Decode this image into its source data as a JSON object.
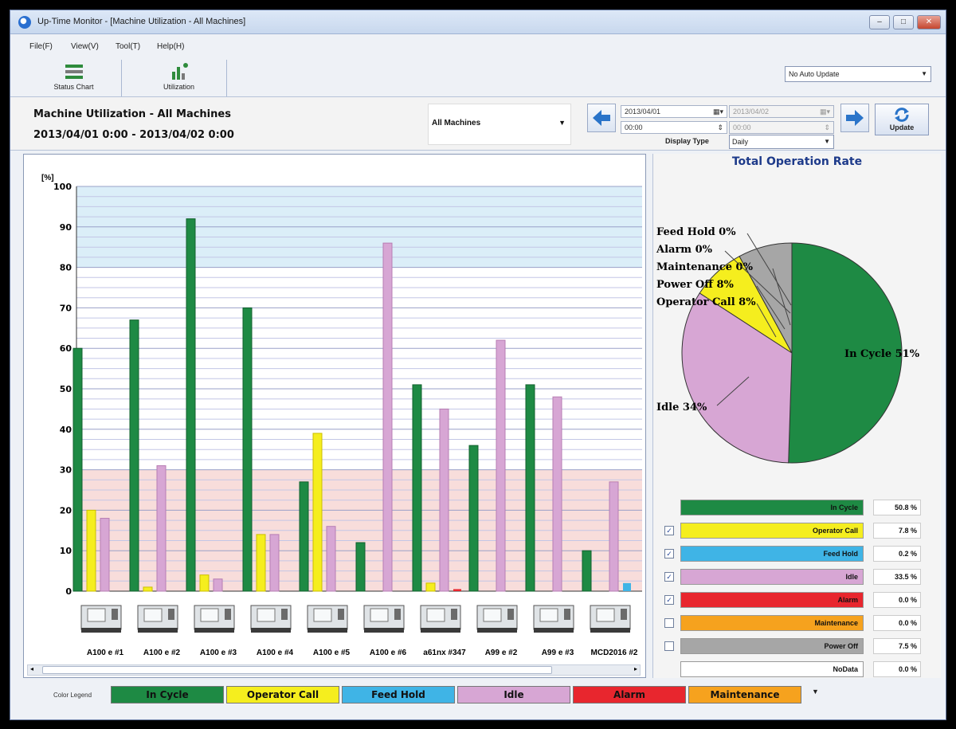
{
  "window": {
    "title": "Up-Time Monitor - [Machine Utilization - All Machines]",
    "controls": [
      "–",
      "□",
      "✕"
    ]
  },
  "menu": [
    "File(F)",
    "View(V)",
    "Tool(T)",
    "Help(H)"
  ],
  "toolbar": {
    "status_chart_label": "Status Chart",
    "utilization_label": "Utilization",
    "auto_update_value": "No Auto Update"
  },
  "header": {
    "title": "Machine Utilization - All Machines",
    "range": "2013/04/01 0:00 - 2013/04/02 0:00",
    "machine_select_value": "All Machines",
    "start_date": "2013/04/01",
    "start_time": "00:00",
    "end_date": "2013/04/02",
    "end_time": "00:00",
    "update_label": "Update",
    "display_type_label": "Display Type",
    "display_type_value": "Daily"
  },
  "colors": {
    "in_cycle": "#1e8a44",
    "operator_call": "#f5ee1e",
    "feed_hold": "#3fb4e6",
    "idle": "#d7a6d4",
    "alarm": "#e8262e",
    "maintenance": "#f6a21e",
    "power_off": "#a6a6a6",
    "no_data": "#ffffff"
  },
  "chart_data": [
    {
      "type": "bar",
      "ylabel": "[%]",
      "ylim": [
        0,
        100
      ],
      "yticks": [
        0,
        10,
        20,
        30,
        40,
        50,
        60,
        70,
        80,
        90,
        100
      ],
      "categories": [
        "A100 e  #1",
        "A100 e  #2",
        "A100 e  #3",
        "A100 e  #4",
        "A100 e  #5",
        "A100 e  #6",
        "a61nx  #347",
        "A99 e  #2",
        "A99 e  #3",
        "MCD2016  #2"
      ],
      "series": [
        {
          "name": "In Cycle",
          "color": "#1e8a44",
          "values": [
            60,
            67,
            92,
            70,
            27,
            12,
            51,
            36,
            51,
            10
          ]
        },
        {
          "name": "Operator Call",
          "color": "#f5ee1e",
          "values": [
            20,
            1,
            4,
            14,
            39,
            0,
            2,
            0,
            0,
            0
          ]
        },
        {
          "name": "Idle",
          "color": "#d7a6d4",
          "values": [
            18,
            31,
            3,
            14,
            16,
            86,
            45,
            62,
            48,
            27
          ]
        }
      ],
      "extra_marks": [
        {
          "category": "a61nx  #347",
          "name": "Alarm",
          "value": 0.5
        },
        {
          "category": "MCD2016  #2",
          "name": "Feed Hold",
          "value": 2
        }
      ],
      "bands": {
        "upper_from": 80,
        "lower_to": 30
      }
    },
    {
      "type": "pie",
      "title": "Total Operation Rate",
      "slices": [
        {
          "label": "In Cycle 51%",
          "name": "In Cycle",
          "value": 51,
          "color": "#1e8a44"
        },
        {
          "label": "Idle 34%",
          "name": "Idle",
          "value": 34,
          "color": "#d7a6d4"
        },
        {
          "label": "Operator Call 8%",
          "name": "Operator Call",
          "value": 8,
          "color": "#f5ee1e"
        },
        {
          "label": "Power Off 8%",
          "name": "Power Off",
          "value": 8,
          "color": "#a6a6a6"
        },
        {
          "label": "Maintenance 0%",
          "name": "Maintenance",
          "value": 0,
          "color": "#f6a21e"
        },
        {
          "label": "Alarm 0%",
          "name": "Alarm",
          "value": 0,
          "color": "#e8262e"
        },
        {
          "label": "Feed Hold 0%",
          "name": "Feed Hold",
          "value": 0,
          "color": "#3fb4e6"
        }
      ]
    }
  ],
  "summary": [
    {
      "name": "In Cycle",
      "value": "50.8 %",
      "color": "#1e8a44",
      "checkbox": false,
      "checked": false
    },
    {
      "name": "Operator Call",
      "value": "7.8 %",
      "color": "#f5ee1e",
      "checkbox": true,
      "checked": true
    },
    {
      "name": "Feed Hold",
      "value": "0.2 %",
      "color": "#3fb4e6",
      "checkbox": true,
      "checked": true
    },
    {
      "name": "Idle",
      "value": "33.5 %",
      "color": "#d7a6d4",
      "checkbox": true,
      "checked": true
    },
    {
      "name": "Alarm",
      "value": "0.0 %",
      "color": "#e8262e",
      "checkbox": true,
      "checked": true
    },
    {
      "name": "Maintenance",
      "value": "0.0 %",
      "color": "#f6a21e",
      "checkbox": true,
      "checked": false
    },
    {
      "name": "Power Off",
      "value": "7.5 %",
      "color": "#a6a6a6",
      "checkbox": true,
      "checked": false
    },
    {
      "name": "NoData",
      "value": "0.0 %",
      "color": "#ffffff",
      "checkbox": false,
      "checked": false
    }
  ],
  "color_legend": {
    "label": "Color Legend",
    "items": [
      {
        "name": "In Cycle",
        "color": "#1e8a44"
      },
      {
        "name": "Operator Call",
        "color": "#f5ee1e"
      },
      {
        "name": "Feed Hold",
        "color": "#3fb4e6"
      },
      {
        "name": "Idle",
        "color": "#d7a6d4"
      },
      {
        "name": "Alarm",
        "color": "#e8262e"
      },
      {
        "name": "Maintenance",
        "color": "#f6a21e"
      }
    ],
    "more": "▼"
  }
}
